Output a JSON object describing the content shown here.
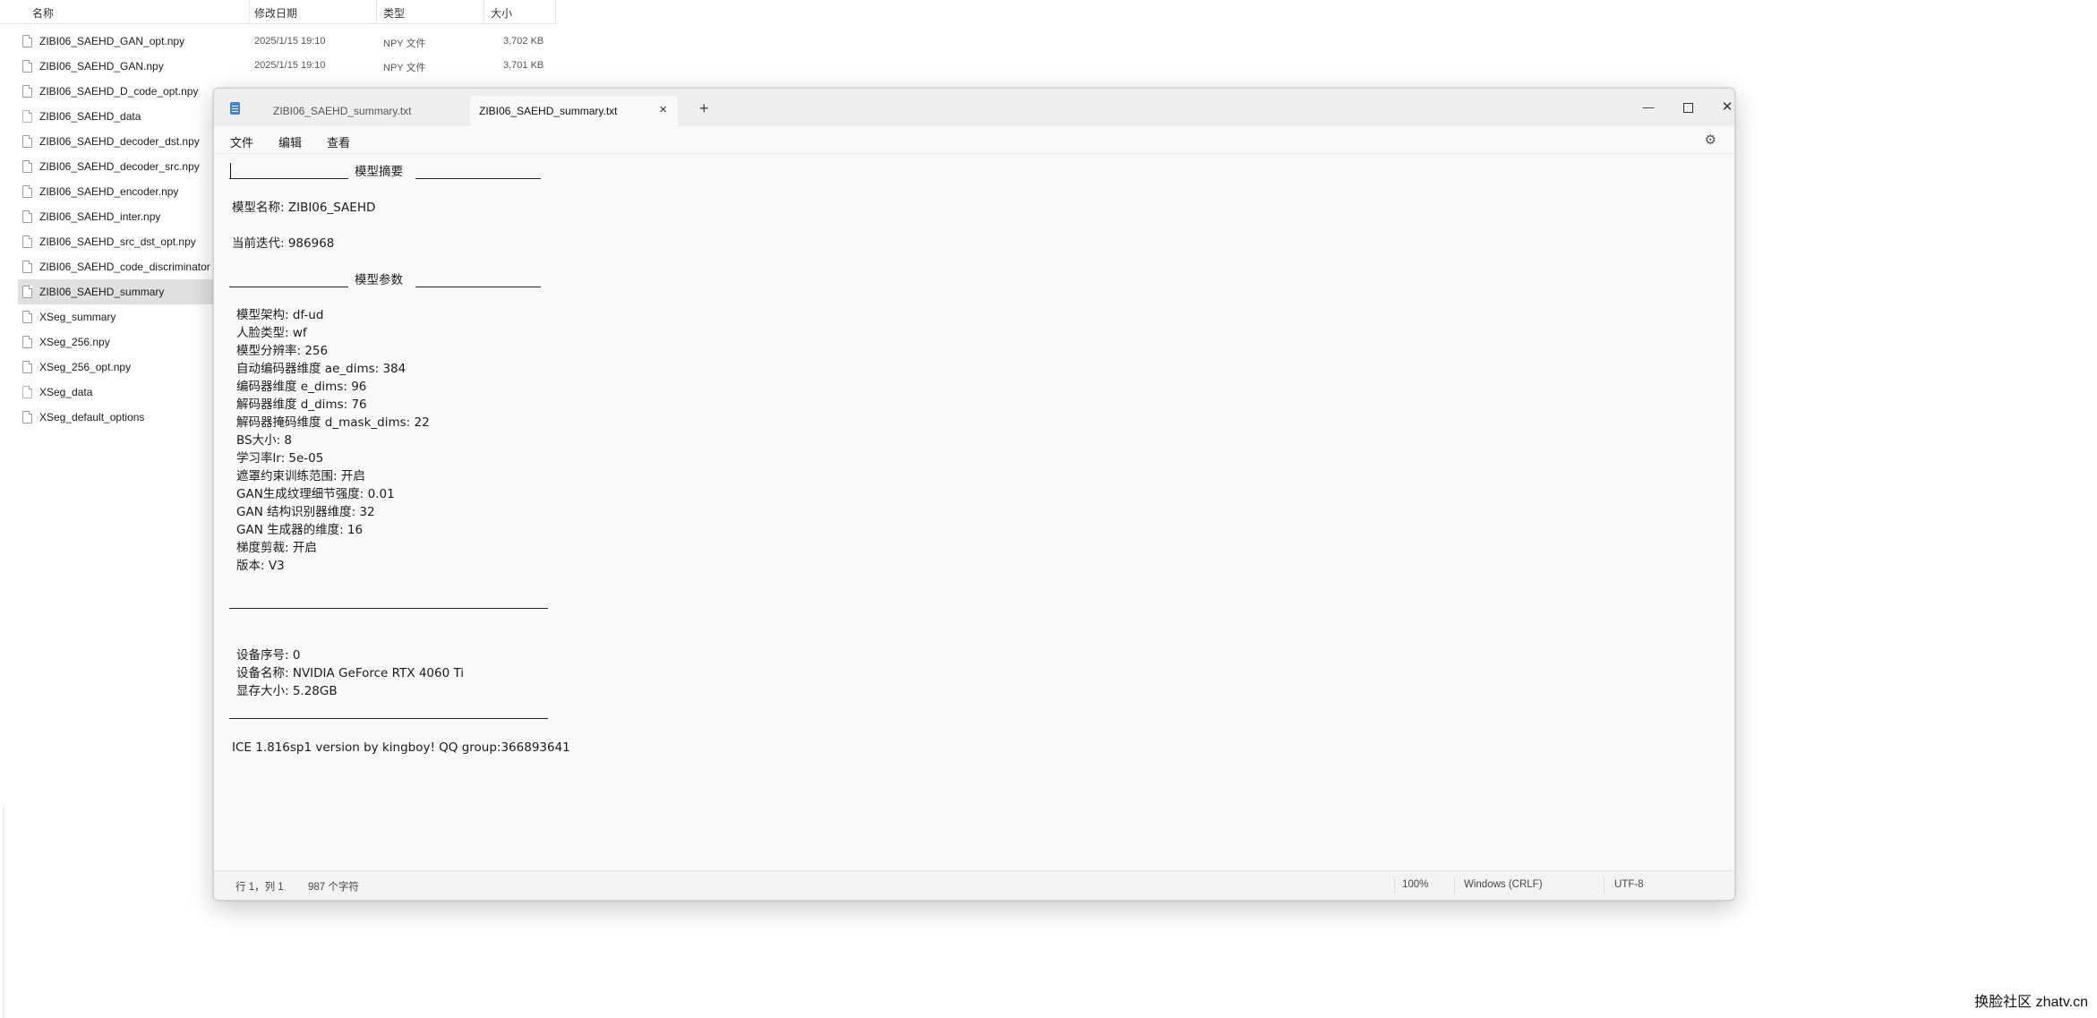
{
  "explorer": {
    "columns": {
      "name": "名称",
      "modified": "修改日期",
      "type": "类型",
      "size": "大小"
    },
    "files": [
      {
        "name": "ZIBI06_SAEHD_GAN_opt.npy",
        "date": "2025/1/15 19:10",
        "type": "NPY 文件",
        "size": "3,702 KB"
      },
      {
        "name": "ZIBI06_SAEHD_GAN.npy",
        "date": "2025/1/15 19:10",
        "type": "NPY 文件",
        "size": "3,701 KB"
      },
      {
        "name": "ZIBI06_SAEHD_D_code_opt.npy"
      },
      {
        "name": "ZIBI06_SAEHD_data"
      },
      {
        "name": "ZIBI06_SAEHD_decoder_dst.npy"
      },
      {
        "name": "ZIBI06_SAEHD_decoder_src.npy"
      },
      {
        "name": "ZIBI06_SAEHD_encoder.npy"
      },
      {
        "name": "ZIBI06_SAEHD_inter.npy"
      },
      {
        "name": "ZIBI06_SAEHD_src_dst_opt.npy"
      },
      {
        "name": "ZIBI06_SAEHD_code_discriminator"
      },
      {
        "name": "ZIBI06_SAEHD_summary",
        "selected": true
      },
      {
        "name": "XSeg_summary"
      },
      {
        "name": "XSeg_256.npy"
      },
      {
        "name": "XSeg_256_opt.npy"
      },
      {
        "name": "XSeg_data"
      },
      {
        "name": "XSeg_default_options"
      }
    ]
  },
  "notepad": {
    "tabs": [
      {
        "label": "ZIBI06_SAEHD_summary.txt",
        "active": false
      },
      {
        "label": "ZIBI06_SAEHD_summary.txt",
        "active": true
      }
    ],
    "tab_close": "×",
    "tab_add": "+",
    "window_controls": {
      "minimize": "—",
      "close": "✕"
    },
    "menu": {
      "file": "文件",
      "edit": "编辑",
      "view": "查看"
    },
    "settings_icon": "gear-icon",
    "content": {
      "header1": "模型摘要",
      "model_name": "模型名称: ZIBI06_SAEHD",
      "iteration": "当前迭代: 986968",
      "header2": "模型参数",
      "params": [
        "模型架构: df-ud",
        "人脸类型: wf",
        "模型分辨率: 256",
        "自动编码器维度 ae_dims: 384",
        "编码器维度 e_dims: 96",
        "解码器维度 d_dims: 76",
        "解码器掩码维度 d_mask_dims: 22",
        "BS大小: 8",
        "学习率lr: 5e-05",
        "遮罩约束训练范围: 开启",
        "GAN生成纹理细节强度: 0.01",
        "GAN 结构识别器维度: 32",
        "GAN 生成器的维度: 16",
        "梯度剪裁: 开启",
        "版本: V3"
      ],
      "device": [
        "设备序号: 0",
        "设备名称: NVIDIA GeForce RTX 4060 Ti",
        "显存大小: 5.28GB"
      ],
      "footer": "ICE 1.816sp1 version by kingboy! QQ group:366893641"
    },
    "status": {
      "position": "行 1，列 1",
      "chars": "987 个字符",
      "zoom": "100%",
      "line_ending": "Windows (CRLF)",
      "encoding": "UTF-8"
    }
  },
  "watermark": "换脸社区 zhatv.cn"
}
